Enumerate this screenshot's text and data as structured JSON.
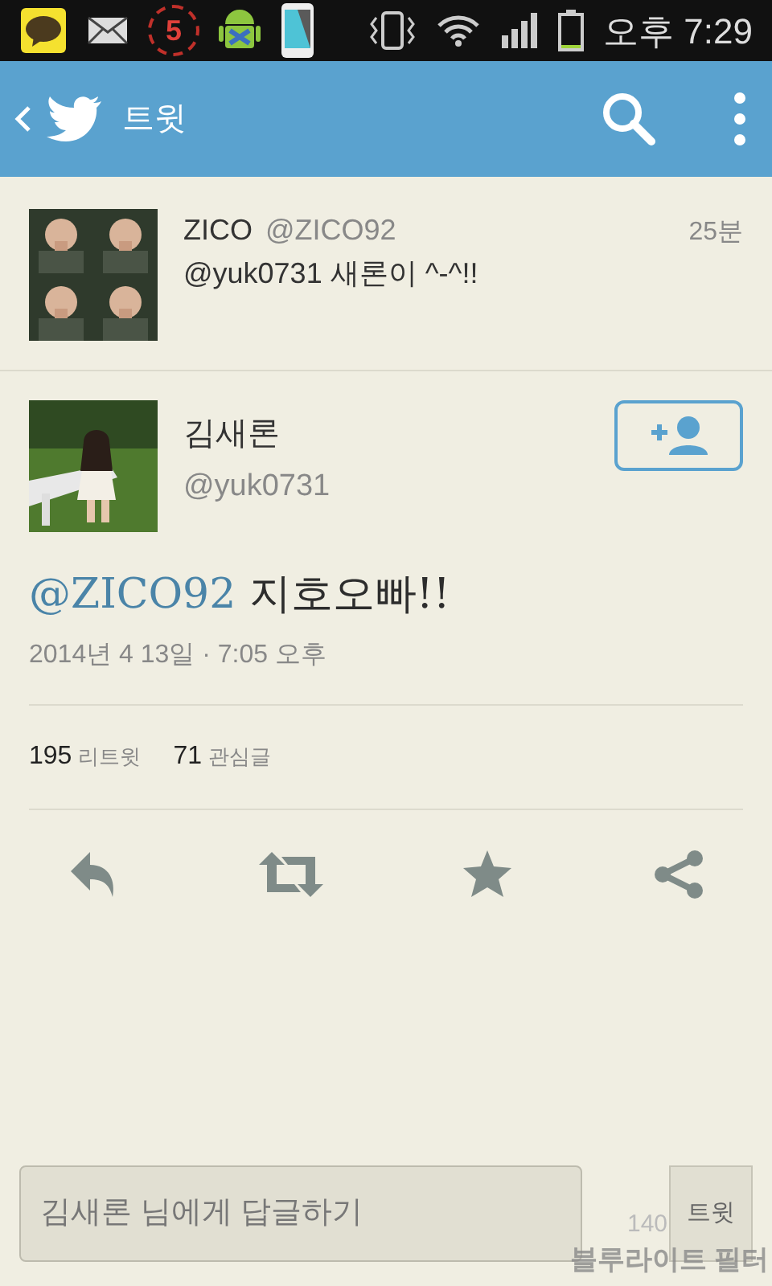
{
  "status_bar": {
    "notification_count": "5",
    "time": "오후 7:29"
  },
  "header": {
    "title": "트윗"
  },
  "reply_to": {
    "name": "ZICO",
    "handle": "@ZICO92",
    "time": "25분",
    "text": "@yuk0731 새론이 ^-^!!"
  },
  "tweet": {
    "name": "김새론",
    "handle": "@yuk0731",
    "mention": "@ZICO92",
    "text": " 지호오빠!!",
    "date": "2014년 4 13일 · 7:05 오후",
    "stats": [
      {
        "count": "195",
        "label": "리트윗"
      },
      {
        "count": "71",
        "label": "관심글"
      }
    ],
    "actions": [
      {
        "kind": "reply"
      },
      {
        "kind": "retweet"
      },
      {
        "kind": "favorite"
      },
      {
        "kind": "share"
      }
    ]
  },
  "composer": {
    "placeholder": "김새론 님에게 답글하기",
    "counter": "140",
    "button": "트윗"
  },
  "overlay_label": "블루라이트 필터"
}
